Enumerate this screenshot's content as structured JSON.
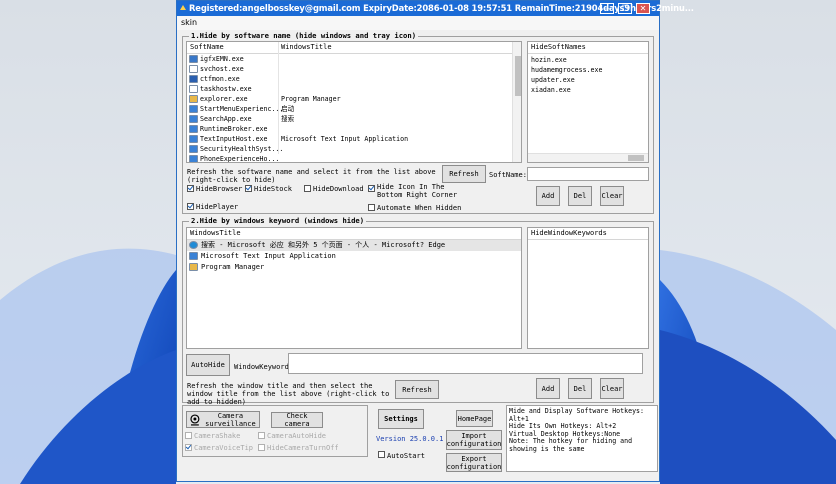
{
  "window": {
    "title": "Registered:angelbosskey@gmail.com   ExpiryDate:2086-01-08 19:57:51   RemainTime:21904days9hours2minu...",
    "controls": {
      "minimize": "—",
      "restore": "❐",
      "close": "✕"
    }
  },
  "menu": {
    "skin": "skin"
  },
  "section1": {
    "title": "1.Hide by software name (hide windows and tray icon)",
    "columns": [
      "SoftName",
      "WindowsTitle"
    ],
    "rows": [
      {
        "name": "igfxEMN.exe",
        "title": "",
        "icon": "app-icon",
        "color": "#3a78c8"
      },
      {
        "name": "svchost.exe",
        "title": "",
        "icon": "service-icon",
        "color": "#ffffff"
      },
      {
        "name": "ctfmon.exe",
        "title": "",
        "icon": "pen-icon",
        "color": "#2a5fb0"
      },
      {
        "name": "taskhostw.exe",
        "title": "",
        "icon": "service-icon",
        "color": "#ffffff"
      },
      {
        "name": "explorer.exe",
        "title": "Program Manager",
        "icon": "folder-icon",
        "color": "#e8b84a"
      },
      {
        "name": "StartMenuExperienc...",
        "title": "启动",
        "icon": "window-icon",
        "color": "#3b82d6"
      },
      {
        "name": "SearchApp.exe",
        "title": "搜索",
        "icon": "window-icon",
        "color": "#3b82d6"
      },
      {
        "name": "RuntimeBroker.exe",
        "title": "",
        "icon": "window-icon",
        "color": "#3b82d6"
      },
      {
        "name": "TextInputHost.exe",
        "title": "Microsoft Text Input Application",
        "icon": "window-icon",
        "color": "#3b82d6"
      },
      {
        "name": "SecurityHealthSyst...",
        "title": "",
        "icon": "window-icon",
        "color": "#3b82d6"
      },
      {
        "name": "PhoneExperienceHo...",
        "title": "",
        "icon": "window-icon",
        "color": "#3b82d6"
      }
    ],
    "hide_list_header": "HideSoftNames",
    "hide_list": [
      "hozin.exe",
      "hudamemgrocess.exe",
      "updater.exe",
      "xiadan.exe"
    ],
    "refresh_hint": "Refresh the software name and select it from the list above (right-click to hide)",
    "refresh_label": "Refresh",
    "softname_label": "SoftName:",
    "add_label": "Add",
    "del_label": "Del",
    "clear_label": "Clear",
    "checkboxes": [
      {
        "label": "HideBrowser",
        "checked": true
      },
      {
        "label": "HideStock",
        "checked": true
      },
      {
        "label": "HideDownload",
        "checked": false
      },
      {
        "label": "HideIconInTheBottomRight",
        "text": "Hide Icon In The Bottom Right Corner",
        "checked": true
      },
      {
        "label": "HidePlayer",
        "checked": true
      },
      {
        "label": "Automate When Hidden",
        "checked": false
      }
    ]
  },
  "section2": {
    "title": "2.Hide by windows keyword (windows hide)",
    "column": "WindowsTitle",
    "rows": [
      {
        "title": "搜索 - Microsoft 必应 和另外 5 个页面 - 个人 - Microsoft? Edge",
        "icon": "edge-icon",
        "color": "#1f8bd6"
      },
      {
        "title": "Microsoft Text Input Application",
        "icon": "window-icon",
        "color": "#3b82d6"
      },
      {
        "title": "Program Manager",
        "icon": "folder-icon",
        "color": "#e8b84a"
      }
    ],
    "keyword_header": "HideWindowKeywords",
    "autohide_label": "AutoHide",
    "keyword_label": "WindowKeyword:",
    "refresh_hint": "Refresh the window title and then select the window title from the list above (right-click to add to hidden)",
    "refresh_label": "Refresh",
    "add_label": "Add",
    "del_label": "Del",
    "clear_label": "Clear"
  },
  "bottom": {
    "camera_label": "Camera surveillance",
    "check_camera_label": "Check camera",
    "camera_options": [
      {
        "label": "CameraShake",
        "checked": false
      },
      {
        "label": "CameraAutoHide",
        "checked": false
      },
      {
        "label": "CameraVoiceTip",
        "checked": true
      },
      {
        "label": "HideCameraTurnOff",
        "checked": false
      }
    ],
    "settings_label": "Settings",
    "version": "Version 25.0.0.1",
    "autostart_label": "AutoStart",
    "homepage_label": "HomePage",
    "import_label": "Import configuration",
    "export_label": "Export configuration",
    "hotkeys_text": "Mide and Display Software Hotkeys: Alt+1\nHide Its Own Hotkeys: Alt+2\nVirtual Desktop Hotkeys:None\nNote: The hotkey for hiding and showing is the same"
  }
}
